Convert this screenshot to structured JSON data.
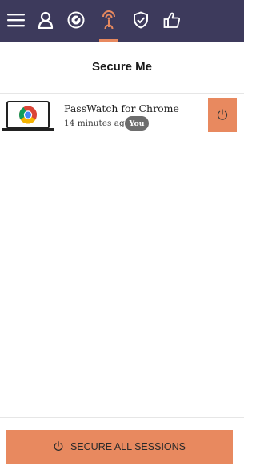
{
  "nav": {
    "items": [
      {
        "id": "menu",
        "icon": "hamburger-menu-icon"
      },
      {
        "id": "account",
        "icon": "user-icon"
      },
      {
        "id": "dashboard",
        "icon": "gauge-icon"
      },
      {
        "id": "sessions",
        "icon": "signal-tower-icon",
        "active": true
      },
      {
        "id": "security",
        "icon": "shield-check-icon"
      },
      {
        "id": "feedback",
        "icon": "thumbs-up-icon"
      }
    ]
  },
  "page": {
    "title": "Secure Me"
  },
  "sessions": [
    {
      "device_icon": "laptop-chrome-icon",
      "name": "PassWatch for Chrome",
      "time": "14 minutes ago",
      "badge": "You",
      "action_icon": "power-icon"
    }
  ],
  "footer": {
    "secure_all_label": "SECURE ALL SESSIONS",
    "icon": "power-icon"
  },
  "colors": {
    "topbar": "#3d3a5c",
    "accent": "#e8895f",
    "badge": "#6d6d6d",
    "icon_light": "#ffffff"
  }
}
